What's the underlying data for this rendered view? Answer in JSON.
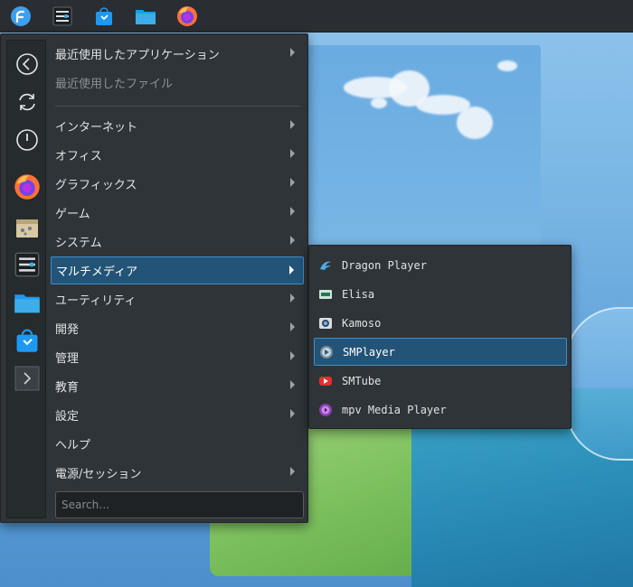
{
  "taskbar": {
    "icons": [
      "fedora-start-icon",
      "system-settings-icon",
      "software-store-icon",
      "file-manager-icon",
      "firefox-icon"
    ]
  },
  "favorites": {
    "icons": [
      "back-icon",
      "refresh-icon",
      "power-icon",
      "firefox-icon",
      "archive-icon",
      "system-settings-icon",
      "file-manager-icon",
      "software-store-icon",
      "expand-arrow-icon"
    ]
  },
  "menu": {
    "recent_apps": "最近使用したアプリケーション",
    "recent_files": "最近使用したファイル",
    "categories": [
      "インターネット",
      "オフィス",
      "グラフィックス",
      "ゲーム",
      "システム",
      "マルチメディア",
      "ユーティリティ",
      "開発",
      "管理",
      "教育",
      "設定",
      "ヘルプ",
      "電源/セッション"
    ],
    "active_category": "マルチメディア"
  },
  "search": {
    "placeholder": "Search…"
  },
  "submenu": {
    "items": [
      "Dragon Player",
      "Elisa",
      "Kamoso",
      "SMPlayer",
      "SMTube",
      "mpv Media Player"
    ],
    "active_item": "SMPlayer"
  },
  "colors": {
    "menu_bg": "#2e3438",
    "highlight_bg": "#235478",
    "highlight_border": "#3d8fce",
    "taskbar_bg": "#2a2e32"
  }
}
